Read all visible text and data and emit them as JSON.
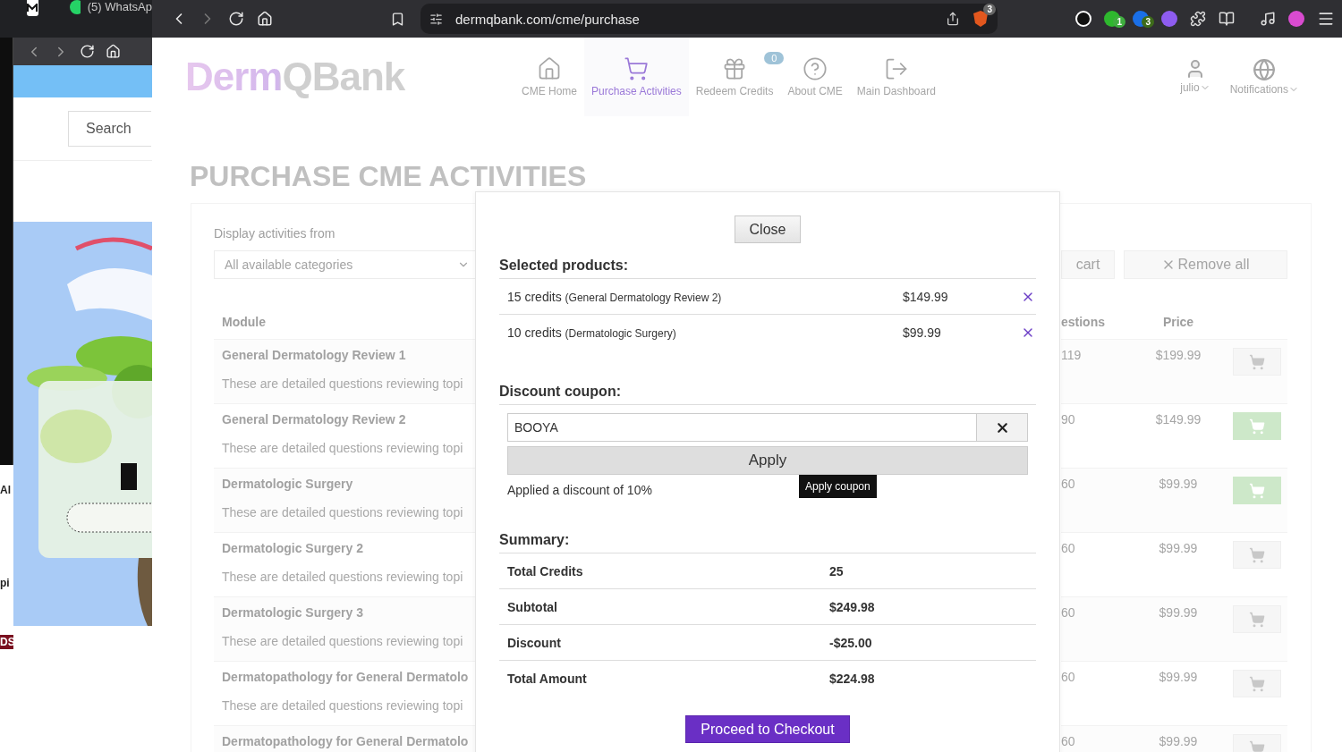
{
  "left_window": {
    "tab_title": "(5) WhatsAp",
    "search": {
      "placeholder": "Search"
    },
    "edge_texts": [
      {
        "text": "Al",
        "kind": "plain"
      },
      {
        "text": "pi",
        "kind": "plain"
      },
      {
        "text": "DS",
        "kind": "badge"
      }
    ]
  },
  "browser": {
    "url": "dermqbank.com/cme/purchase",
    "shields_count": "3",
    "extension_badges": [
      "1",
      "3"
    ]
  },
  "header": {
    "logo": "DermQBank",
    "nav": [
      {
        "label": "CME Home",
        "selected": false
      },
      {
        "label": "Purchase Activities",
        "selected": true
      },
      {
        "label": "Redeem Credits",
        "selected": false,
        "badge": "0"
      },
      {
        "label": "About CME",
        "selected": false
      },
      {
        "label": "Main Dashboard",
        "selected": false
      }
    ],
    "user": "julio",
    "notifications": "Notifications"
  },
  "title": "PURCHASE CME ACTIVITIES",
  "filter": {
    "label": "Display activities from",
    "value": "All available categories"
  },
  "actions": [
    "cart",
    "Remove all"
  ],
  "table": {
    "columns": [
      "Module",
      "estions",
      "Price"
    ],
    "rows": [
      {
        "module": "General Dermatology Review 1",
        "description": "These are detailed questions reviewing topi",
        "questions": "119",
        "price": "$199.99",
        "in_cart": false
      },
      {
        "module": "General Dermatology Review 2",
        "description": "These are detailed questions reviewing topi",
        "questions": "90",
        "price": "$149.99",
        "in_cart": true
      },
      {
        "module": "Dermatologic Surgery",
        "description": "These are detailed questions reviewing topi",
        "questions": "60",
        "price": "$99.99",
        "in_cart": true
      },
      {
        "module": "Dermatologic Surgery 2",
        "description": "These are detailed questions reviewing topi",
        "questions": "60",
        "price": "$99.99",
        "in_cart": false
      },
      {
        "module": "Dermatologic Surgery 3",
        "description": "These are detailed questions reviewing topi",
        "questions": "60",
        "price": "$99.99",
        "in_cart": false
      },
      {
        "module": "Dermatopathology for General Dermatolo",
        "description": "These are detailed questions reviewing topi",
        "questions": "60",
        "price": "$99.99",
        "in_cart": false
      },
      {
        "module": "Dermatopathology for General Dermatolo",
        "questions": "60",
        "price": "$99.99",
        "in_cart": false
      }
    ]
  },
  "modal": {
    "close": "Close",
    "selected_heading": "Selected products:",
    "products": [
      {
        "credits": "15 credits",
        "module": "(General Dermatology Review 2)",
        "price": "$149.99"
      },
      {
        "credits": "10 credits",
        "module": "(Dermatologic Surgery)",
        "price": "$99.99"
      }
    ],
    "coupon_heading": "Discount coupon:",
    "coupon_value": "BOOYA",
    "apply": "Apply",
    "message": "Applied a discount of 10%",
    "tooltip": "Apply coupon",
    "summary_heading": "Summary:",
    "summary": [
      {
        "label": "Total Credits",
        "value": "25"
      },
      {
        "label": "Subtotal",
        "value": "$249.98"
      },
      {
        "label": "Discount",
        "value": "-$25.00"
      },
      {
        "label": "Total Amount",
        "value": "$224.98"
      }
    ],
    "checkout": "Proceed to Checkout"
  }
}
